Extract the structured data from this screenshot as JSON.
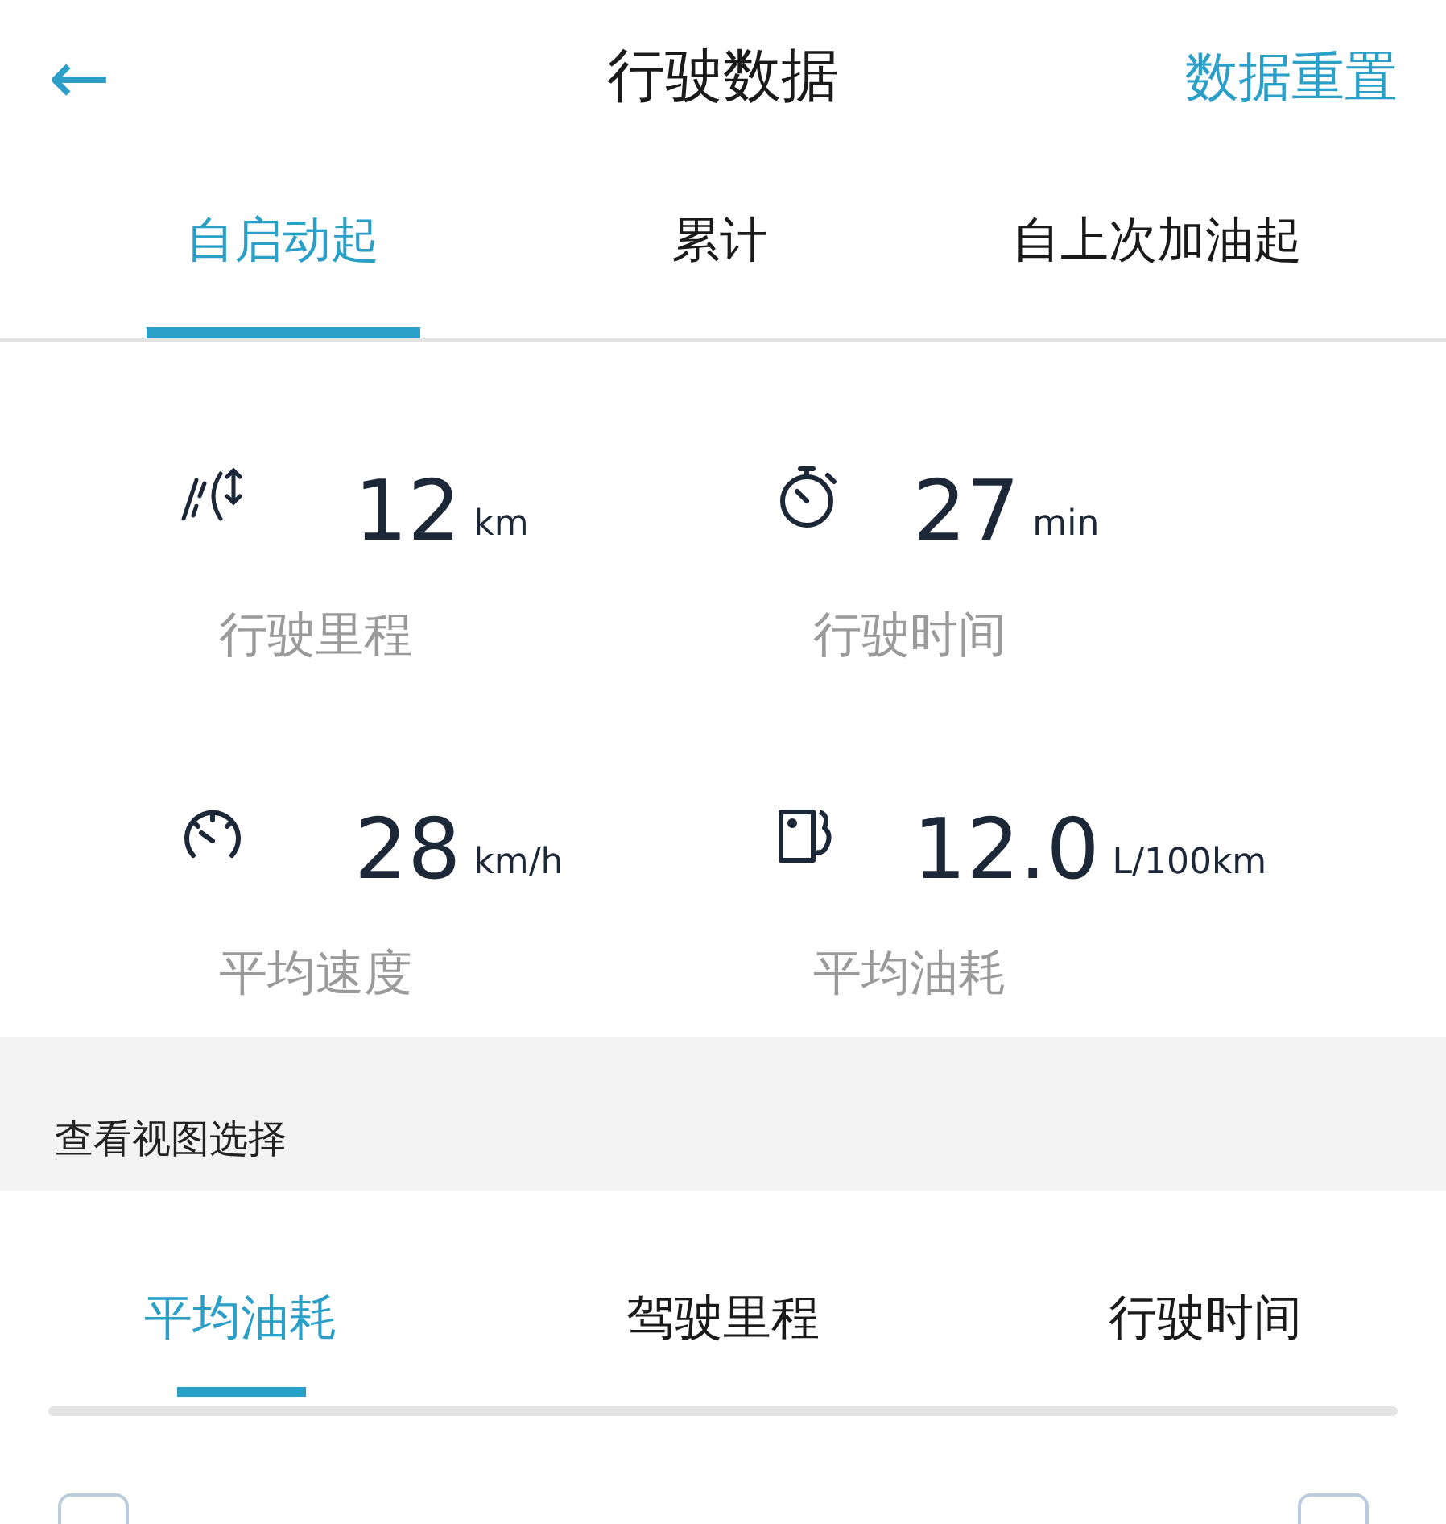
{
  "header": {
    "back": "←",
    "title": "行驶数据",
    "action": "数据重置"
  },
  "tabs": [
    {
      "label": "自启动起",
      "selected": true
    },
    {
      "label": "累计",
      "selected": false
    },
    {
      "label": "自上次加油起",
      "selected": false
    }
  ],
  "stats": [
    {
      "kind": "distance",
      "value": "12",
      "unit": "km",
      "label": "行驶里程"
    },
    {
      "kind": "time",
      "value": "27",
      "unit": "min",
      "label": "行驶时间"
    },
    {
      "kind": "speed",
      "value": "28",
      "unit": "km/h",
      "label": "平均速度"
    },
    {
      "kind": "fuel",
      "value": "12.0",
      "unit": "L/100km",
      "label": "平均油耗"
    }
  ],
  "view_section": {
    "title": "查看视图选择"
  },
  "view_tabs": [
    {
      "label": "平均油耗",
      "selected": true
    },
    {
      "label": "驾驶里程",
      "selected": false
    },
    {
      "label": "行驶时间",
      "selected": false
    }
  ]
}
